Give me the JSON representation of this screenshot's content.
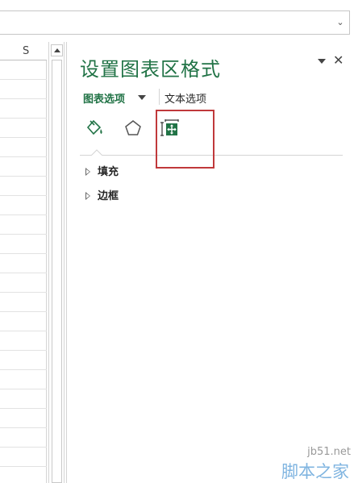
{
  "spreadsheet": {
    "column_header": "S"
  },
  "pane": {
    "title": "设置图表区格式",
    "tabs": {
      "chart_options": "图表选项",
      "text_options": "文本选项"
    },
    "icons": [
      "fill-line-icon",
      "effects-icon",
      "size-properties-icon"
    ],
    "sections": [
      {
        "label": "填充",
        "expanded": false
      },
      {
        "label": "边框",
        "expanded": false
      }
    ],
    "accent_color": "#217346",
    "highlight_color": "#c0393b"
  },
  "watermark": {
    "url": "jb51.net",
    "name": "脚本之家"
  }
}
